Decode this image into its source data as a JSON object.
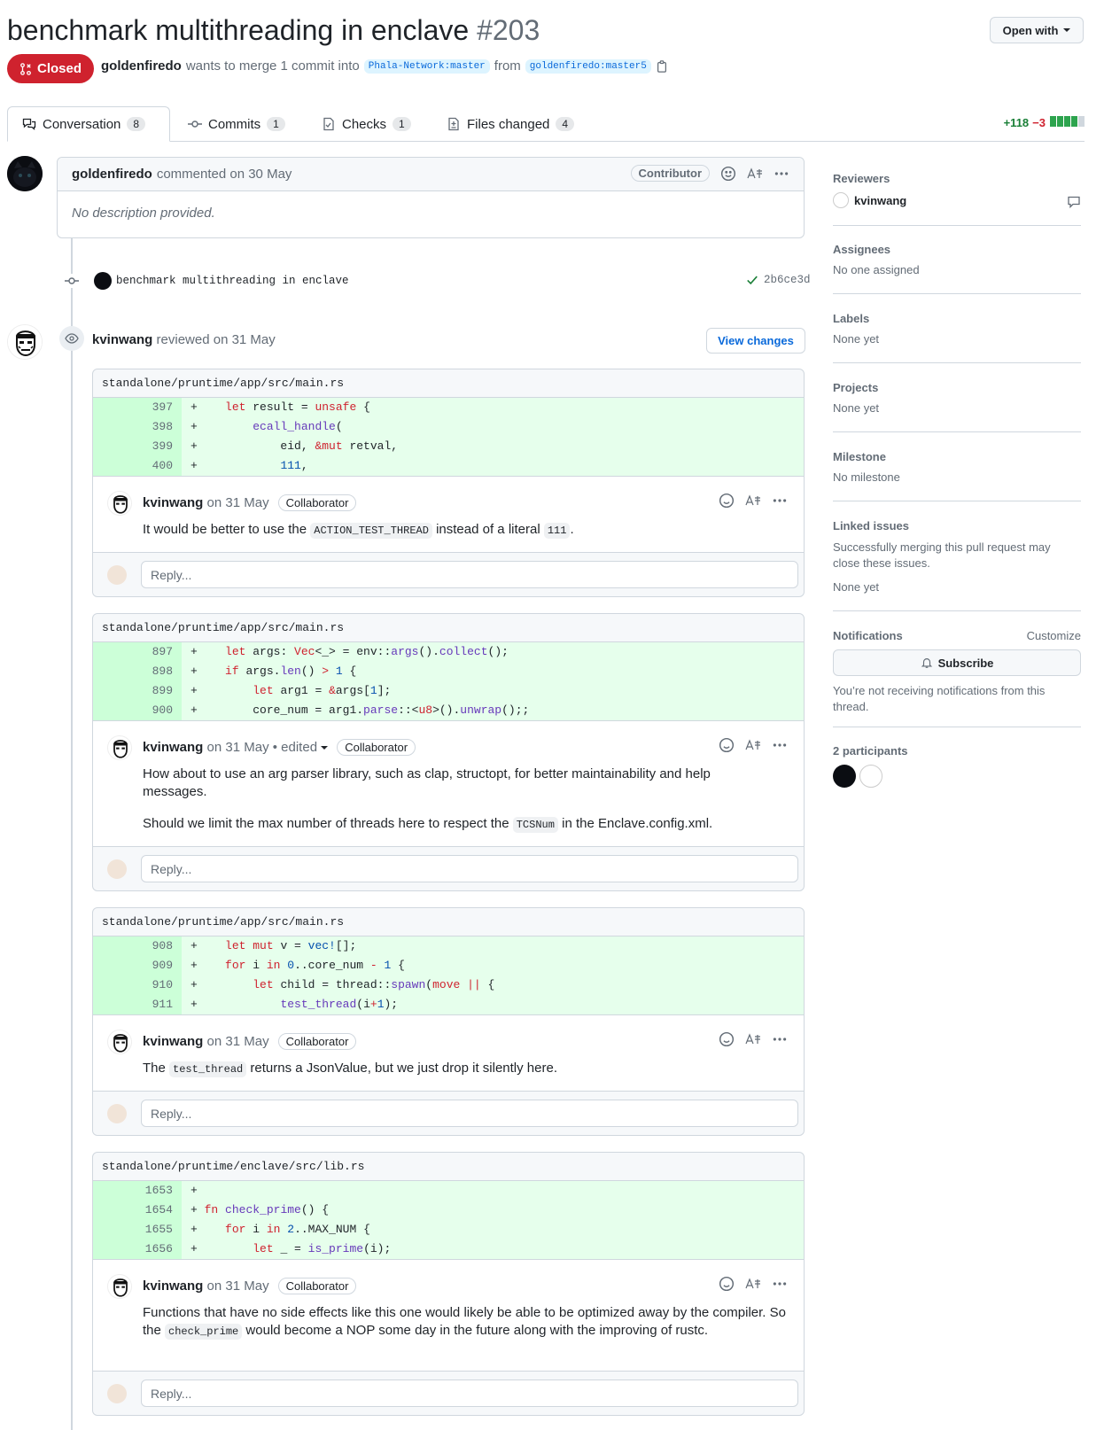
{
  "pr": {
    "title": "benchmark multithreading in enclave",
    "number": "#203",
    "state": "Closed",
    "author": "goldenfiredo",
    "merge_text": "wants to merge 1 commit into",
    "base_branch": "Phala-Network:master",
    "from_text": "from",
    "head_branch": "goldenfiredo:master5"
  },
  "header": {
    "open_with": "Open with"
  },
  "tabs": [
    {
      "label": "Conversation",
      "count": "8"
    },
    {
      "label": "Commits",
      "count": "1"
    },
    {
      "label": "Checks",
      "count": "1"
    },
    {
      "label": "Files changed",
      "count": "4"
    }
  ],
  "diffstat": {
    "additions": "+118",
    "deletions": "−3"
  },
  "opening_comment": {
    "author": "goldenfiredo",
    "action": "commented on 30 May",
    "badge": "Contributor",
    "body": "No description provided."
  },
  "commit": {
    "message": "benchmark multithreading in enclave",
    "sha": "2b6ce3d"
  },
  "review": {
    "author": "kvinwang",
    "action": "reviewed on 31 May",
    "view_changes": "View changes"
  },
  "threads": [
    {
      "file": "standalone/pruntime/app/src/main.rs",
      "lines": [
        {
          "n": "397",
          "sign": "+"
        },
        {
          "n": "398",
          "sign": "+"
        },
        {
          "n": "399",
          "sign": "+"
        },
        {
          "n": "400",
          "sign": "+"
        }
      ],
      "author": "kvinwang",
      "date": "on 31 May",
      "badge": "Collaborator",
      "reply": "Reply..."
    },
    {
      "file": "standalone/pruntime/app/src/main.rs",
      "lines": [
        {
          "n": "897",
          "sign": "+"
        },
        {
          "n": "898",
          "sign": "+"
        },
        {
          "n": "899",
          "sign": "+"
        },
        {
          "n": "900",
          "sign": "+"
        }
      ],
      "author": "kvinwang",
      "date": "on 31 May",
      "edited": "• edited",
      "badge": "Collaborator",
      "reply": "Reply..."
    },
    {
      "file": "standalone/pruntime/app/src/main.rs",
      "lines": [
        {
          "n": "908",
          "sign": "+"
        },
        {
          "n": "909",
          "sign": "+"
        },
        {
          "n": "910",
          "sign": "+"
        },
        {
          "n": "911",
          "sign": "+"
        }
      ],
      "author": "kvinwang",
      "date": "on 31 May",
      "badge": "Collaborator",
      "reply": "Reply..."
    },
    {
      "file": "standalone/pruntime/enclave/src/lib.rs",
      "lines": [
        {
          "n": "1653",
          "sign": "+"
        },
        {
          "n": "1654",
          "sign": "+"
        },
        {
          "n": "1655",
          "sign": "+"
        },
        {
          "n": "1656",
          "sign": "+"
        }
      ],
      "author": "kvinwang",
      "date": "on 31 May",
      "badge": "Collaborator",
      "reply": "Reply..."
    }
  ],
  "comment_text": {
    "t1_a": "It would be better to use the",
    "t1_code1": "ACTION_TEST_THREAD",
    "t1_b": "instead of a literal",
    "t1_code2": "111",
    "t1_c": ".",
    "t2_p1": "How about to use an arg parser library, such as clap, structopt, for better maintainability and help messages.",
    "t2_a": "Should we limit the max number of threads here to respect the",
    "t2_code": "TCSNum",
    "t2_b": "in the Enclave.config.xml.",
    "t3_a": "The",
    "t3_code": "test_thread",
    "t3_b": "returns a JsonValue, but we just drop it silently here.",
    "t4_a": "Functions that have no side effects like this one would likely be able to be optimized away by the compiler. So the",
    "t4_code": "check_prime",
    "t4_b": "would become a NOP some day in the future along with the improving of rustc."
  },
  "sidebar": {
    "reviewers_title": "Reviewers",
    "reviewer": "kvinwang",
    "assignees_title": "Assignees",
    "assignees_value": "No one assigned",
    "labels_title": "Labels",
    "labels_value": "None yet",
    "projects_title": "Projects",
    "projects_value": "None yet",
    "milestone_title": "Milestone",
    "milestone_value": "No milestone",
    "linked_title": "Linked issues",
    "linked_desc": "Successfully merging this pull request may close these issues.",
    "linked_value": "None yet",
    "notifications_title": "Notifications",
    "customize": "Customize",
    "subscribe": "Subscribe",
    "notif_desc": "You’re not receiving notifications from this thread.",
    "participants": "2 participants"
  },
  "colors": {
    "closed": "#cf222e",
    "add_bg": "#e6ffec",
    "addition": "#1a7f37",
    "link": "#0969da"
  }
}
